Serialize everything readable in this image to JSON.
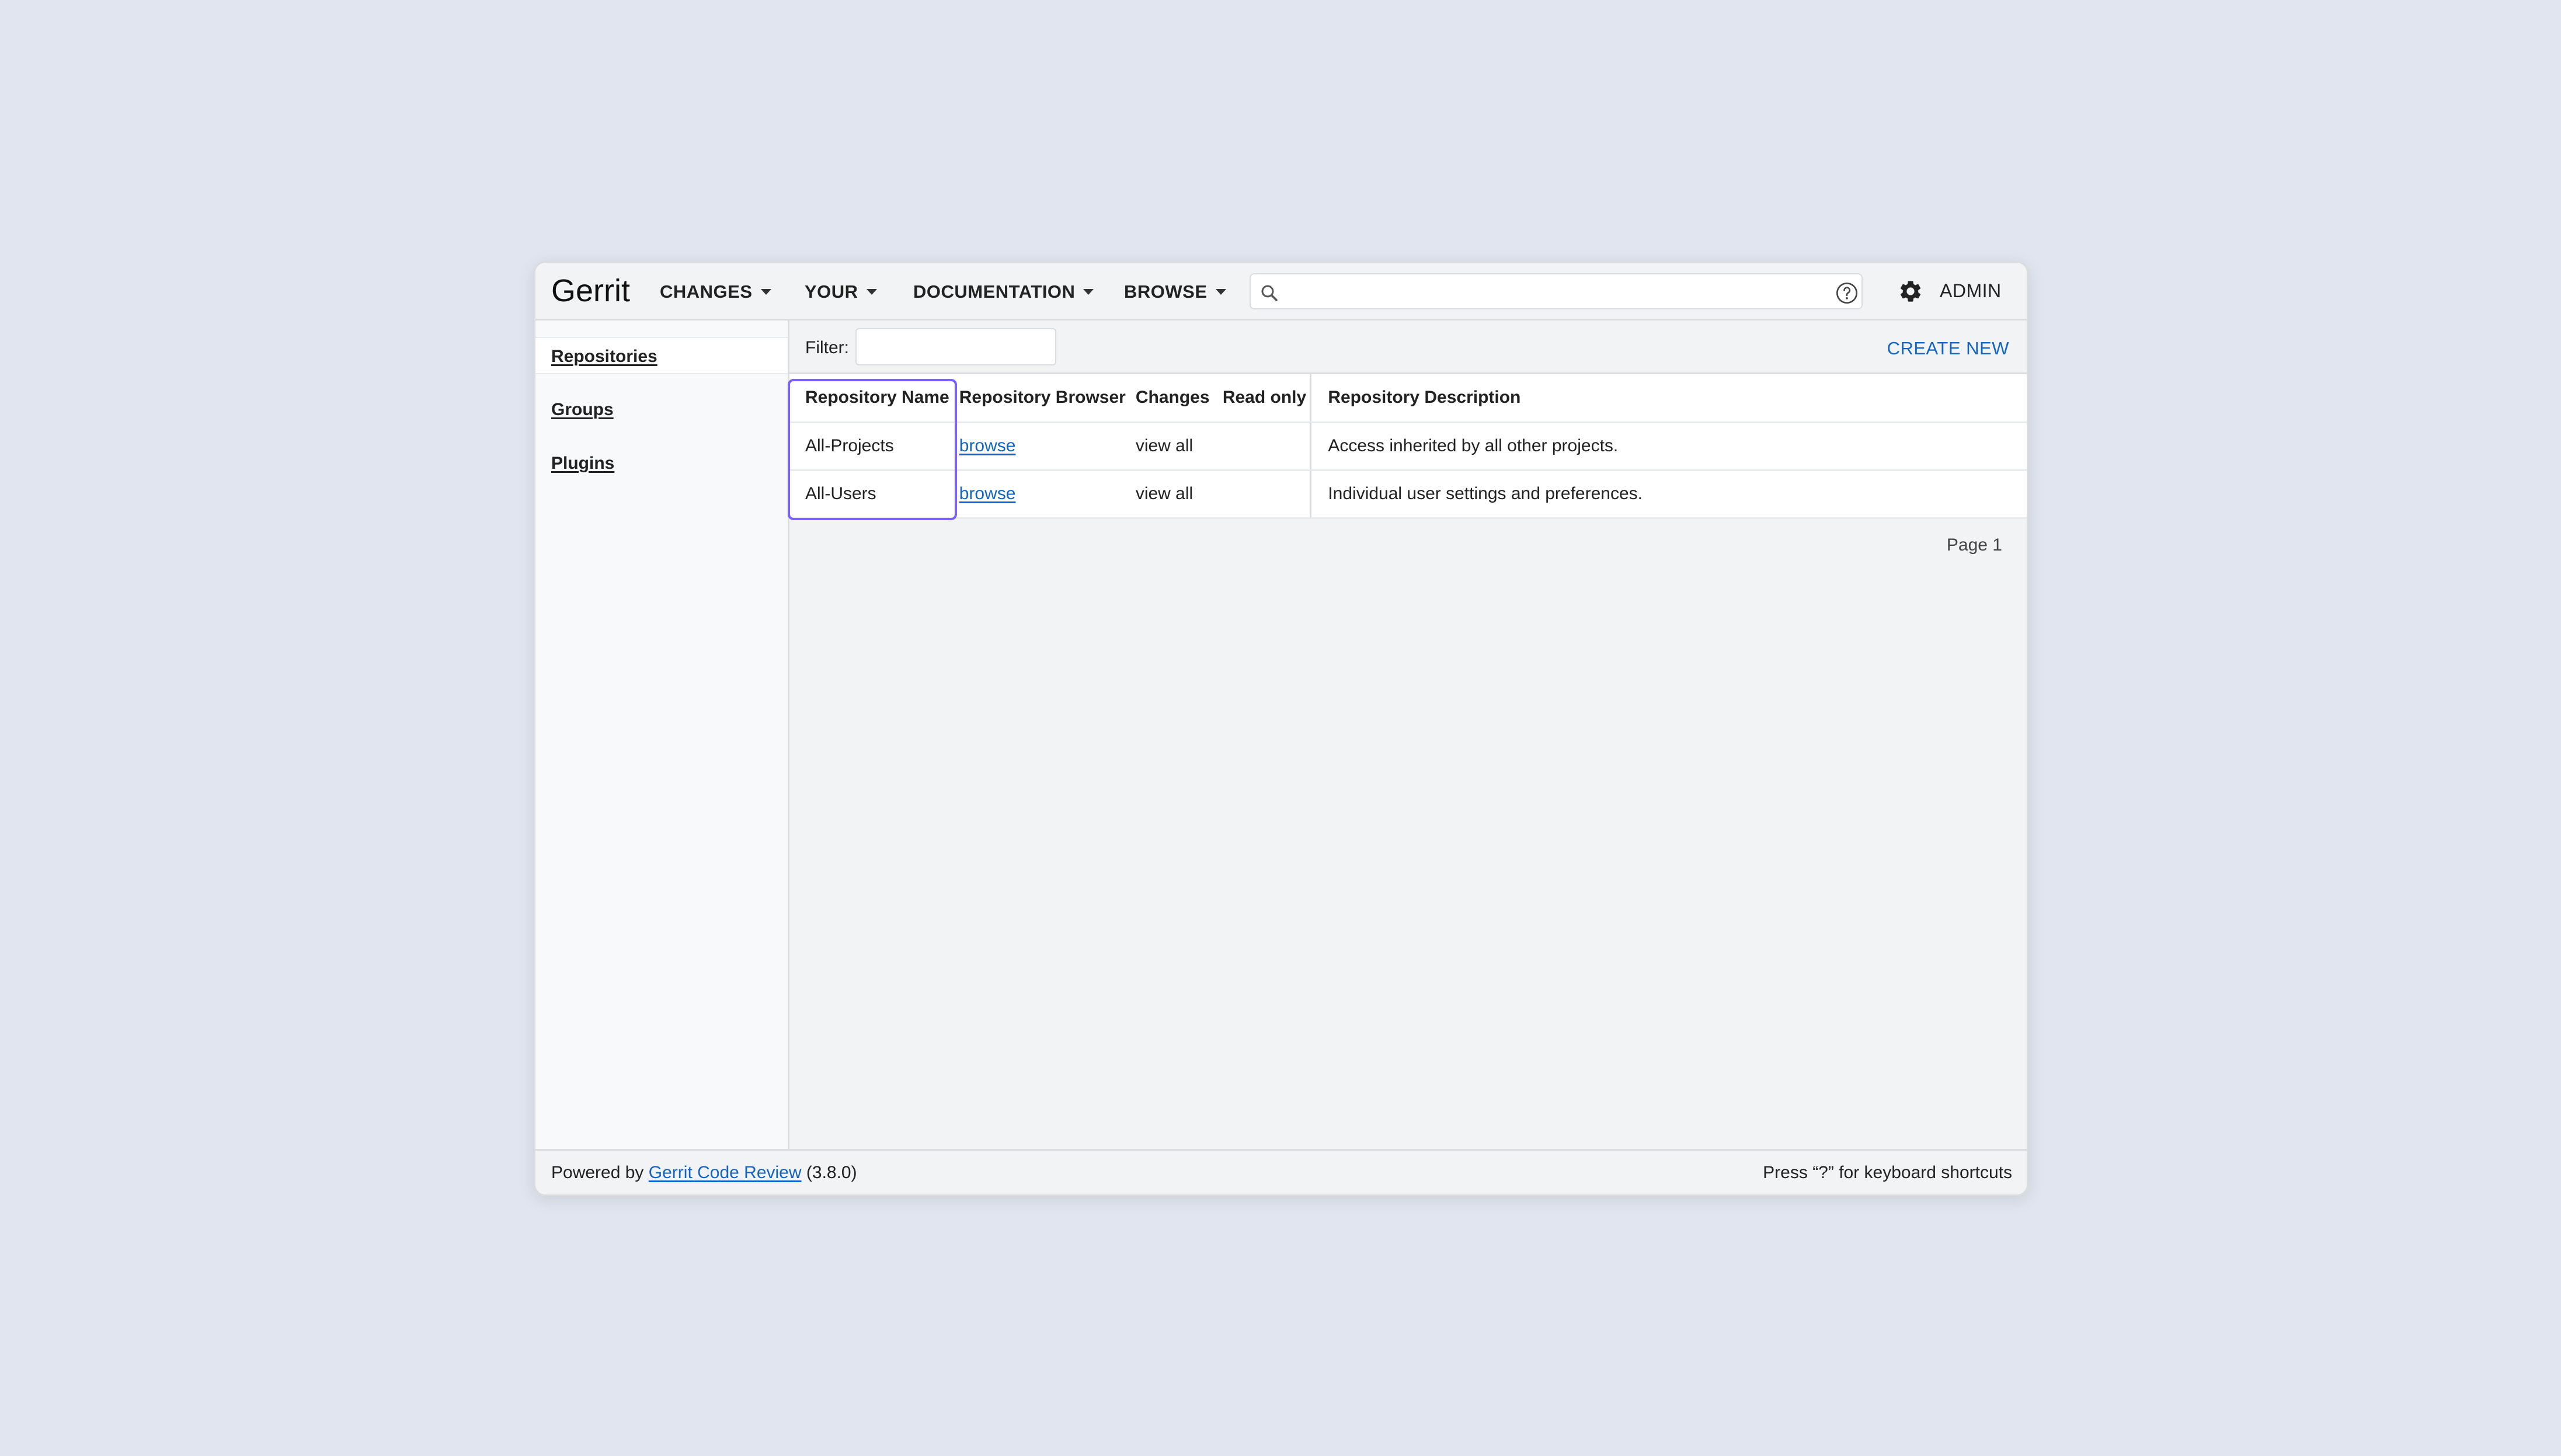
{
  "header": {
    "logo": "Gerrit",
    "menus": [
      {
        "label": "CHANGES"
      },
      {
        "label": "YOUR"
      },
      {
        "label": "DOCUMENTATION"
      },
      {
        "label": "BROWSE"
      }
    ],
    "search": {
      "value": "",
      "placeholder": ""
    },
    "admin_label": "ADMIN"
  },
  "sidebar": {
    "items": [
      {
        "label": "Repositories",
        "selected": true
      },
      {
        "label": "Groups"
      },
      {
        "label": "Plugins"
      }
    ]
  },
  "main": {
    "filter_label": "Filter:",
    "filter_value": "",
    "create_new_label": "CREATE NEW",
    "table": {
      "headers": [
        "Repository Name",
        "Repository Browser",
        "Changes",
        "Read only",
        "Repository Description"
      ],
      "rows": [
        {
          "name": "All-Projects",
          "browser": "browse",
          "changes": "view all",
          "read_only": "",
          "description": "Access inherited by all other projects."
        },
        {
          "name": "All-Users",
          "browser": "browse",
          "changes": "view all",
          "read_only": "",
          "description": "Individual user settings and preferences."
        }
      ]
    },
    "pager": "Page 1"
  },
  "footer": {
    "powered_by": "Powered by",
    "link": "Gerrit Code Review",
    "version": "(3.8.0)",
    "shortcut_hint": "Press “?” for keyboard shortcuts"
  },
  "colors": {
    "accent_link": "#1565c0",
    "highlight": "#7b61ff",
    "page_background": "#e0e5ef"
  }
}
